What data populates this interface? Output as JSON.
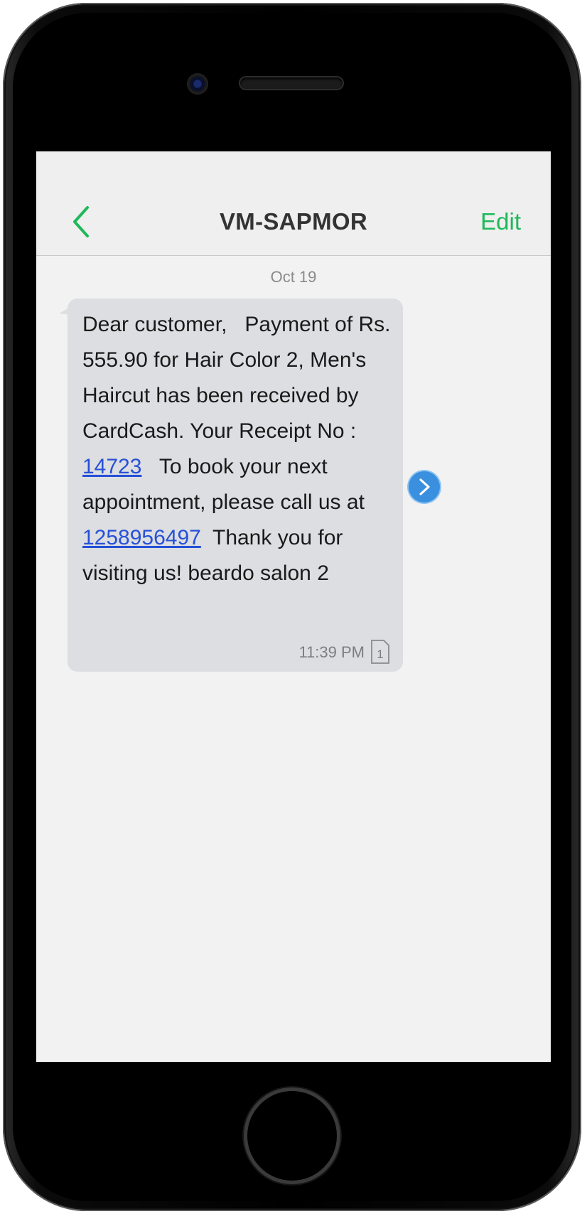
{
  "header": {
    "back_icon": "chevron-left-icon",
    "title": "VM-SAPMOR",
    "edit_label": "Edit"
  },
  "conversation": {
    "date": "Oct 19",
    "message": {
      "text_1": "Dear customer,   Payment of Rs. 555.90 for Hair Color 2, Men's Haircut has been received by CardCash. Your Receipt No : ",
      "link_1": "14723",
      "text_2": "   To book your next appointment, please call us at ",
      "link_2": "1258956497",
      "text_3": "  Thank you for visiting us! beardo salon 2",
      "time": "11:39 PM",
      "sim_label": "1"
    },
    "forward_icon": "chevron-right-icon"
  },
  "colors": {
    "accent": "#1fb85a",
    "link": "#2750d8",
    "bubble": "#dcdee1",
    "forward_button": "#3a8fde"
  }
}
